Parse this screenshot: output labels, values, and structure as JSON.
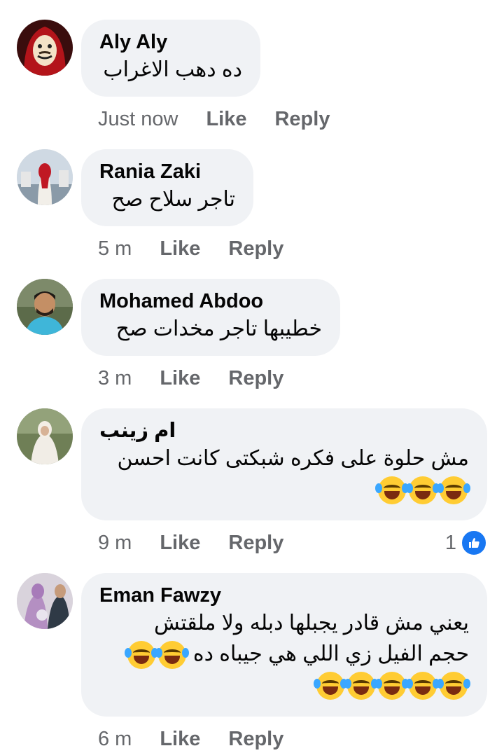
{
  "comments": [
    {
      "name": "Aly Aly",
      "lines": [
        "ده دهب الاغراب"
      ],
      "time": "Just now",
      "like": "Like",
      "reply": "Reply"
    },
    {
      "name": "Rania Zaki",
      "lines": [
        "تاجر سلاح صح"
      ],
      "time": "5 m",
      "like": "Like",
      "reply": "Reply"
    },
    {
      "name": "Mohamed Abdoo",
      "lines": [
        "خطيبها تاجر مخدات صح"
      ],
      "time": "3 m",
      "like": "Like",
      "reply": "Reply"
    },
    {
      "name": "ام زينب",
      "lines": [
        "مش حلوة على فكره شبكتى كانت احسن"
      ],
      "emoji_line": 3,
      "time": "9 m",
      "like": "Like",
      "reply": "Reply",
      "reaction_count": "1"
    },
    {
      "name": "Eman Fawzy",
      "lines": [
        "يعني مش قادر يجبلها دبله ولا ملقتش",
        "حجم الفيل زي اللي هي جيباه ده"
      ],
      "emoji_line": 5,
      "time": "6 m",
      "like": "Like",
      "reply": "Reply"
    }
  ],
  "icons": {
    "emoji": "face-with-tears-of-joy-icon",
    "reaction": "like-thumb-icon"
  },
  "colors": {
    "bubble": "#f0f2f5",
    "meta": "#65676b",
    "like_blue": "#1877f2"
  }
}
